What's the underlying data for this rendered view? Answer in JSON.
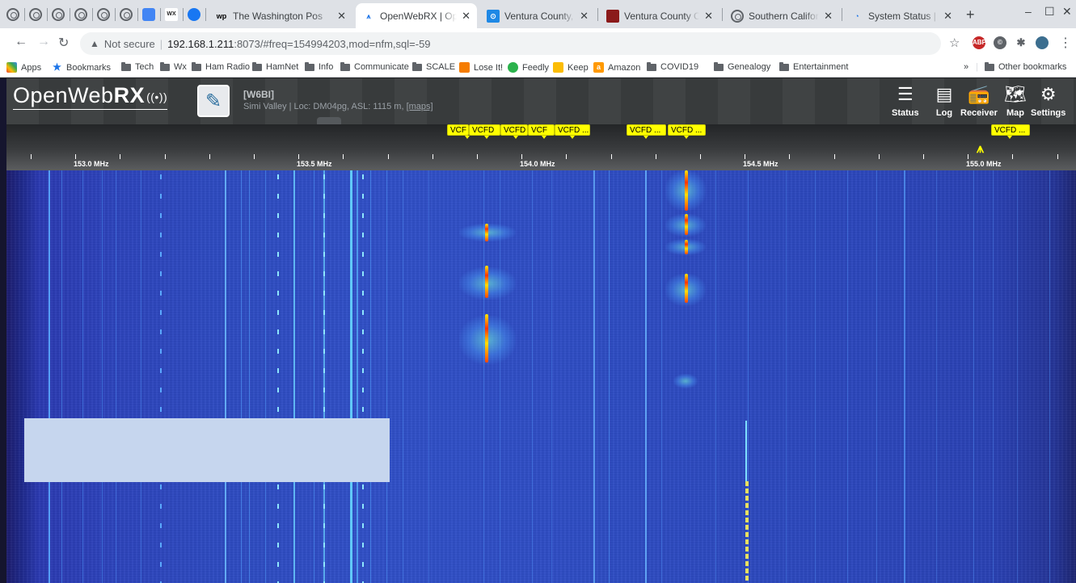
{
  "browser": {
    "pinned_tabs": [
      "globe-icon",
      "globe-icon",
      "globe-icon",
      "globe-icon",
      "globe-icon",
      "globe-icon",
      "calendar-icon",
      "weather-icon",
      "facebook-icon"
    ],
    "tabs": [
      {
        "favicon": "wp",
        "label": "The Washington Pos",
        "active": false
      },
      {
        "favicon": "openwebrx-icon",
        "label": "OpenWebRX | Open",
        "active": true
      },
      {
        "favicon": "ventura-icon",
        "label": "Ventura County, Cali",
        "active": false
      },
      {
        "favicon": "ventura-red-icon",
        "label": "Ventura County Calif",
        "active": false
      },
      {
        "favicon": "globe-icon",
        "label": "Southern California",
        "active": false
      },
      {
        "favicon": "dars-icon",
        "label": "System Status | DAR",
        "active": false
      }
    ],
    "new_tab": "+",
    "window_controls": {
      "minimize": "–",
      "maximize": "☐",
      "close": "✕"
    },
    "address": {
      "security": "Not secure",
      "host": "192.168.1.211",
      "path": ":8073/#freq=154994203,mod=nfm,sql=-59"
    },
    "bookmarks": [
      {
        "label": "Apps",
        "icon": "apps-icon"
      },
      {
        "label": "Bookmarks",
        "icon": "star-icon"
      },
      {
        "label": "Tech",
        "icon": "folder-icon"
      },
      {
        "label": "Wx",
        "icon": "folder-icon"
      },
      {
        "label": "Ham Radio",
        "icon": "folder-icon"
      },
      {
        "label": "HamNet",
        "icon": "folder-icon"
      },
      {
        "label": "Info",
        "icon": "folder-icon"
      },
      {
        "label": "Communicate",
        "icon": "folder-icon"
      },
      {
        "label": "SCALE",
        "icon": "folder-icon"
      },
      {
        "label": "Lose It!",
        "icon": "loseit-icon"
      },
      {
        "label": "Feedly",
        "icon": "feedly-icon"
      },
      {
        "label": "Keep",
        "icon": "keep-icon"
      },
      {
        "label": "Amazon",
        "icon": "amazon-icon"
      },
      {
        "label": "COVID19",
        "icon": "folder-icon"
      },
      {
        "label": "Genealogy",
        "icon": "folder-icon"
      },
      {
        "label": "Entertainment",
        "icon": "folder-icon"
      }
    ],
    "bookmarks_overflow": "»",
    "other_bookmarks": "Other bookmarks"
  },
  "receiver": {
    "logo_text_a": "OpenWeb",
    "logo_text_b": "RX",
    "callsign": "[W6BI]",
    "location_text": "Simi Valley | Loc: DM04pg, ASL: 1115 m,",
    "maps_link": "[maps]",
    "buttons": [
      {
        "label": "Status",
        "icon": "status-icon"
      },
      {
        "label": "Log",
        "icon": "log-icon"
      },
      {
        "label": "Receiver",
        "icon": "receiver-icon"
      },
      {
        "label": "Map",
        "icon": "map-icon"
      },
      {
        "label": "Settings",
        "icon": "settings-icon"
      }
    ]
  },
  "scale": {
    "labels": [
      "153.0 MHz",
      "153.5 MHz",
      "154.0 MHz",
      "154.5 MHz",
      "155.0 MHz"
    ],
    "bookmark_flags": [
      "VCF",
      "VCFD",
      "VCFD",
      "VCF",
      "VCFD ...",
      "VCFD ...",
      "VCFD ...",
      "VCFD ..."
    ],
    "tuned_frequency_mhz": 154.994203
  },
  "colors": {
    "flag": "#ffff00",
    "waterfall_base": "#2e4bc2",
    "signal_hot": "#ff3300"
  }
}
